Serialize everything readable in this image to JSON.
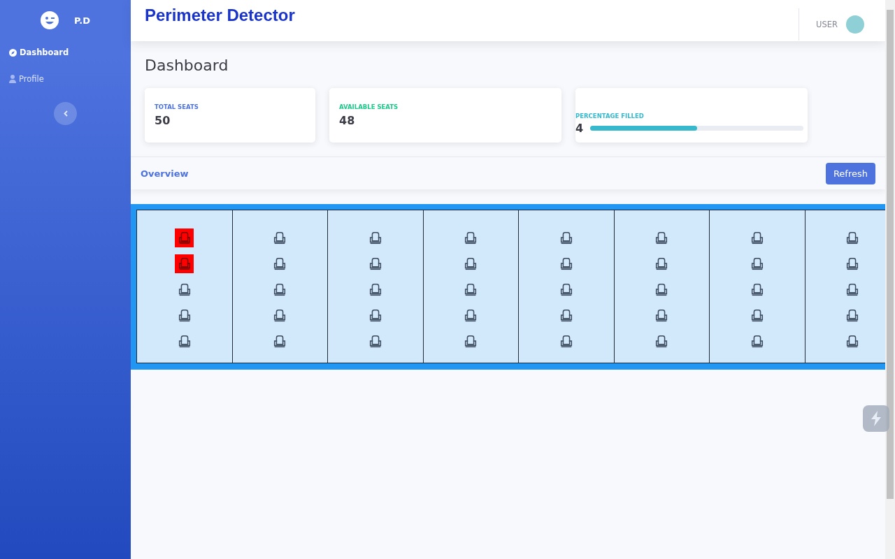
{
  "sidebar": {
    "brand": "P.D",
    "items": [
      {
        "label": "Dashboard",
        "kind": "compass",
        "selected": true
      },
      {
        "label": "Profile",
        "kind": "user",
        "selected": false
      }
    ]
  },
  "header": {
    "title": "Perimeter Detector",
    "user": "USER"
  },
  "page_title": "Dashboard",
  "stats": [
    {
      "label": "TOTAL SEATS",
      "value": "50",
      "color": "#4e73df",
      "kind": "plain"
    },
    {
      "label": "AVAILABLE SEATS",
      "value": "48",
      "color": "#1cc88a",
      "kind": "plain"
    },
    {
      "label": "PERCENTAGE FILLED",
      "value": "4",
      "color": "#36b9cc",
      "kind": "progress",
      "level": 0.5
    }
  ],
  "overview": {
    "title": "Overview",
    "button": "Refresh"
  },
  "seat_columns": [
    {
      "seats": [
        {
          "occupied": true
        },
        {
          "occupied": true
        },
        {
          "occupied": false
        },
        {
          "occupied": false
        },
        {
          "occupied": false
        }
      ]
    },
    {
      "seats": [
        {
          "occupied": false
        },
        {
          "occupied": false
        },
        {
          "occupied": false
        },
        {
          "occupied": false
        },
        {
          "occupied": false
        }
      ]
    },
    {
      "seats": [
        {
          "occupied": false
        },
        {
          "occupied": false
        },
        {
          "occupied": false
        },
        {
          "occupied": false
        },
        {
          "occupied": false
        }
      ]
    },
    {
      "seats": [
        {
          "occupied": false
        },
        {
          "occupied": false
        },
        {
          "occupied": false
        },
        {
          "occupied": false
        },
        {
          "occupied": false
        }
      ]
    },
    {
      "seats": [
        {
          "occupied": false
        },
        {
          "occupied": false
        },
        {
          "occupied": false
        },
        {
          "occupied": false
        },
        {
          "occupied": false
        }
      ]
    },
    {
      "seats": [
        {
          "occupied": false
        },
        {
          "occupied": false
        },
        {
          "occupied": false
        },
        {
          "occupied": false
        },
        {
          "occupied": false
        }
      ]
    },
    {
      "seats": [
        {
          "occupied": false
        },
        {
          "occupied": false
        },
        {
          "occupied": false
        },
        {
          "occupied": false
        },
        {
          "occupied": false
        }
      ]
    },
    {
      "seats": [
        {
          "occupied": false
        },
        {
          "occupied": false
        },
        {
          "occupied": false
        },
        {
          "occupied": false
        },
        {
          "occupied": false
        }
      ]
    }
  ]
}
